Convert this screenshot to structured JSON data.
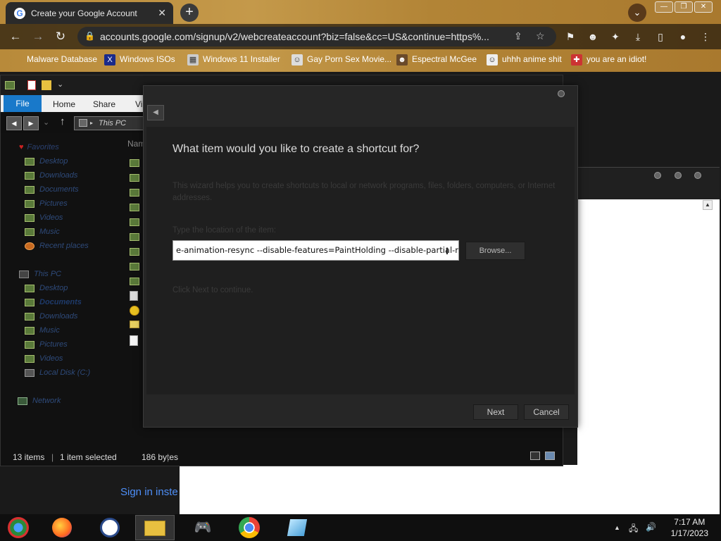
{
  "browser": {
    "tab_title": "Create your Google Account",
    "tab_favicon": "G",
    "url": "accounts.google.com/signup/v2/webcreateaccount?biz=false&cc=US&continue=https%...",
    "bookmarks": [
      "Malware Database",
      "Windows ISOs",
      "Windows 11 Installer",
      "Gay Porn Sex Movie...",
      "Espectral McGee",
      "uhhh anime shit",
      "you are an idiot!"
    ]
  },
  "webpage": {
    "signin_link": "Sign in inste"
  },
  "explorer": {
    "ribbon_tabs": [
      "File",
      "Home",
      "Share",
      "Vi"
    ],
    "address_path": "This PC",
    "column_header": "Nam",
    "tree": {
      "favorites": "Favorites",
      "favorites_items": [
        "Desktop",
        "Downloads",
        "Documents",
        "Pictures",
        "Videos",
        "Music",
        "Recent places"
      ],
      "this_pc": "This PC",
      "this_pc_items": [
        "Desktop",
        "Documents",
        "Downloads",
        "Music",
        "Pictures",
        "Videos",
        "Local Disk (C:)"
      ],
      "network": "Network"
    },
    "status": {
      "items": "13 items",
      "selected": "1 item selected",
      "size": "186 bytes"
    }
  },
  "wizard": {
    "title": "What item would you like to create a shortcut for?",
    "description": "This wizard helps you to create shortcuts to local or network programs, files, folders, computers, or Internet addresses.",
    "location_label": "Type the location of the item:",
    "location_value": "e-animation-resync --disable-features=PaintHolding --disable-partial-r\"",
    "browse_label": "Browse...",
    "continue_text": "Click Next to continue.",
    "next_label": "Next",
    "cancel_label": "Cancel"
  },
  "taskbar": {
    "time": "7:17 AM",
    "date": "1/17/2023"
  }
}
